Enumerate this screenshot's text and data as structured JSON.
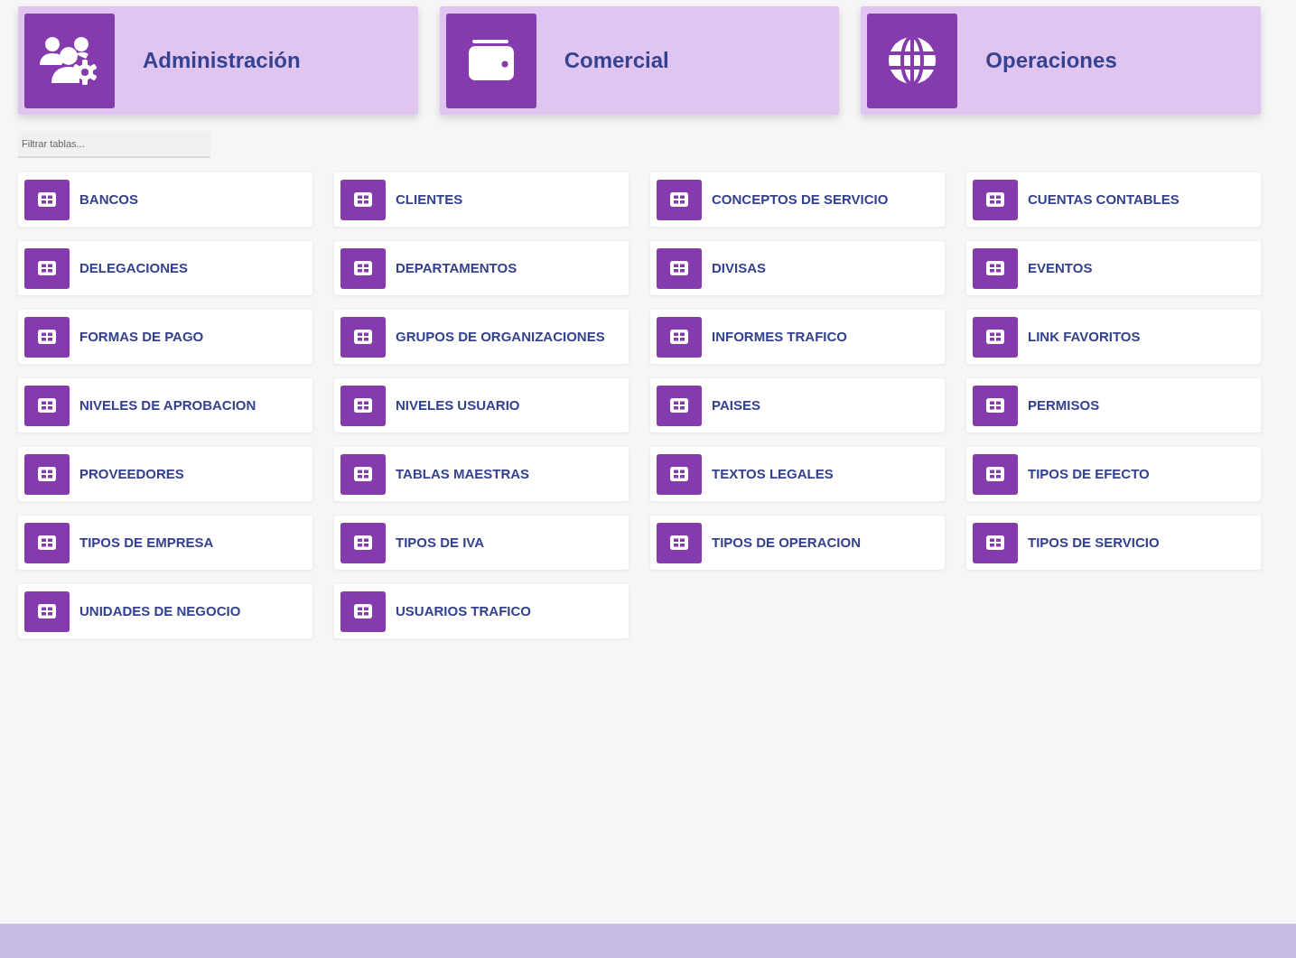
{
  "modules": [
    {
      "label": "Administración"
    },
    {
      "label": "Comercial"
    },
    {
      "label": "Operaciones"
    }
  ],
  "filter": {
    "placeholder": "Filtrar tablas..."
  },
  "tables": [
    "BANCOS",
    "CLIENTES",
    "CONCEPTOS DE SERVICIO",
    "CUENTAS CONTABLES",
    "DELEGACIONES",
    "DEPARTAMENTOS",
    "DIVISAS",
    "EVENTOS",
    "FORMAS DE PAGO",
    "GRUPOS DE ORGANIZACIONES",
    "INFORMES TRAFICO",
    "LINK FAVORITOS",
    "NIVELES DE APROBACION",
    "NIVELES USUARIO",
    "PAISES",
    "PERMISOS",
    "PROVEEDORES",
    "TABLAS MAESTRAS",
    "TEXTOS LEGALES",
    "TIPOS DE EFECTO",
    "TIPOS DE EMPRESA",
    "TIPOS DE IVA",
    "TIPOS DE OPERACION",
    "TIPOS DE SERVICIO",
    "UNIDADES DE NEGOCIO",
    "USUARIOS TRAFICO"
  ]
}
